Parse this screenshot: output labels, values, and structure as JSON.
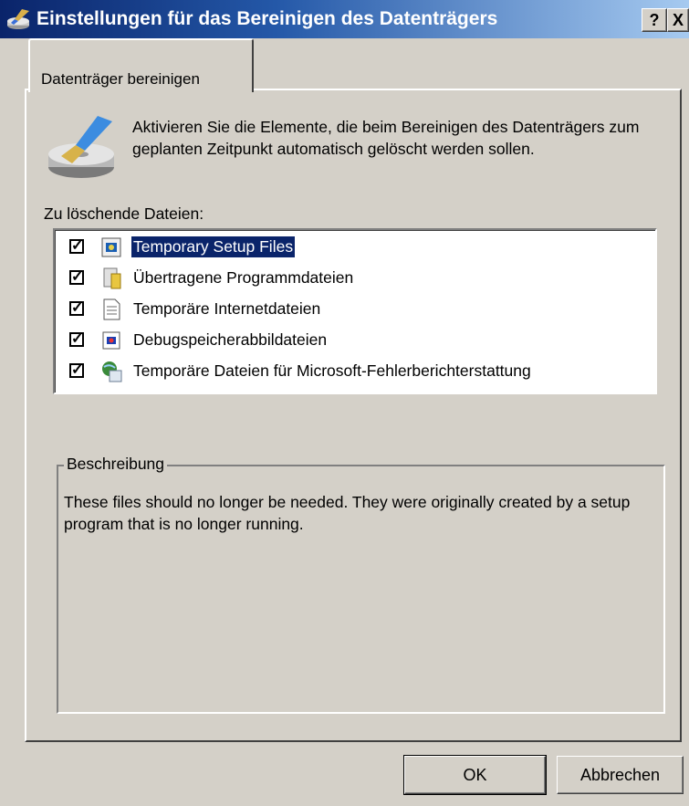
{
  "window": {
    "title": "Einstellungen für das Bereinigen des Datenträgers",
    "help_label": "?",
    "close_label": "X"
  },
  "tab": {
    "label": "Datenträger bereinigen"
  },
  "intro": {
    "text": "Aktivieren Sie die Elemente, die beim Bereinigen des Datenträgers zum geplanten Zeitpunkt automatisch gelöscht werden sollen."
  },
  "files": {
    "label": "Zu löschende Dateien:",
    "items": [
      {
        "label": "Temporary Setup Files",
        "checked": true,
        "selected": true,
        "icon": "setup-files-icon"
      },
      {
        "label": "Übertragene Programmdateien",
        "checked": true,
        "selected": false,
        "icon": "program-files-icon"
      },
      {
        "label": "Temporäre Internetdateien",
        "checked": true,
        "selected": false,
        "icon": "internet-files-icon"
      },
      {
        "label": "Debugspeicherabbildateien",
        "checked": true,
        "selected": false,
        "icon": "dump-files-icon"
      },
      {
        "label": "Temporäre Dateien für Microsoft-Fehlerberichterstattung",
        "checked": true,
        "selected": false,
        "icon": "error-report-icon"
      }
    ]
  },
  "description": {
    "title": "Beschreibung",
    "text": "These files should no longer be needed. They were originally created by a setup program that is no longer running."
  },
  "buttons": {
    "ok": "OK",
    "cancel": "Abbrechen"
  },
  "colors": {
    "titlebar_start": "#0a246a",
    "titlebar_end": "#a6caf0",
    "selection": "#0a246a",
    "face": "#d4d0c8"
  }
}
